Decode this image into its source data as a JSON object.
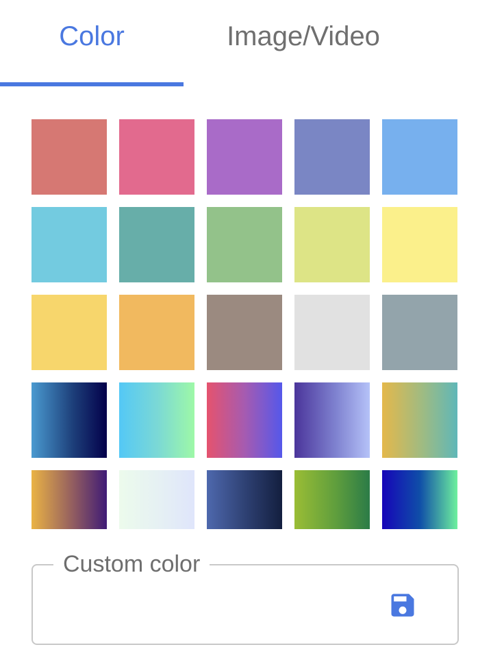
{
  "tabs": [
    {
      "label": "Color",
      "active": true
    },
    {
      "label": "Image/Video",
      "active": false
    }
  ],
  "colors": {
    "accent": "#4a78e0",
    "inactive_tab": "#6f6f6f",
    "input_border": "#c8c8c8"
  },
  "swatches": [
    {
      "name": "swatch-red",
      "fill": "#d67873"
    },
    {
      "name": "swatch-pink",
      "fill": "#e26a8e"
    },
    {
      "name": "swatch-purple",
      "fill": "#a96bc8"
    },
    {
      "name": "swatch-indigo",
      "fill": "#7a86c4"
    },
    {
      "name": "swatch-light-blue",
      "fill": "#77b0ee"
    },
    {
      "name": "swatch-cyan",
      "fill": "#73cbe0"
    },
    {
      "name": "swatch-teal",
      "fill": "#67aea9"
    },
    {
      "name": "swatch-green",
      "fill": "#93c28a"
    },
    {
      "name": "swatch-lime",
      "fill": "#dde486"
    },
    {
      "name": "swatch-yellow",
      "fill": "#fbf08b"
    },
    {
      "name": "swatch-amber",
      "fill": "#f7d66c"
    },
    {
      "name": "swatch-orange",
      "fill": "#f1b95f"
    },
    {
      "name": "swatch-brown",
      "fill": "#9b8a80"
    },
    {
      "name": "swatch-light-gray",
      "fill": "#e1e1e1"
    },
    {
      "name": "swatch-blue-gray",
      "fill": "#93a4ab"
    },
    {
      "name": "swatch-gradient-ocean",
      "fill": "linear-gradient(90deg, #4a9ad0 0%, #1d3f7a 55%, #03004a 100%)"
    },
    {
      "name": "swatch-gradient-sky-mint",
      "fill": "linear-gradient(90deg, #54c8f6 0%, #7ad8d6 50%, #9ef8a7 100%)"
    },
    {
      "name": "swatch-gradient-rose-blue",
      "fill": "linear-gradient(90deg, #e5536e 0%, #a65bb0 50%, #5558ea 100%)"
    },
    {
      "name": "swatch-gradient-violet-periwinkle",
      "fill": "linear-gradient(90deg, #4b359b 0%, #7f82d0 55%, #b5c2f8 100%)"
    },
    {
      "name": "swatch-gradient-gold-teal",
      "fill": "linear-gradient(90deg, #e4b84b 0%, #9dbb84 55%, #5fb7b8 100%)"
    },
    {
      "name": "swatch-gradient-sunset-violet",
      "fill": "linear-gradient(90deg, #eab345 0%, #925d60 55%, #3f1b76 100%)",
      "short": true
    },
    {
      "name": "swatch-gradient-mint-lavender",
      "fill": "linear-gradient(90deg, #ecfbec 0%, #e6f1f3 50%, #dfe5fb 100%)",
      "short": true
    },
    {
      "name": "swatch-gradient-navy",
      "fill": "linear-gradient(90deg, #4e68ad 0%, #2c3e6f 55%, #131f3f 100%)",
      "short": true
    },
    {
      "name": "swatch-gradient-forest",
      "fill": "linear-gradient(90deg, #9abd35 0%, #5f9e3d 55%, #2b7b47 100%)",
      "short": true
    },
    {
      "name": "swatch-gradient-cobalt-mint",
      "fill": "linear-gradient(90deg, #1605b8 0%, #0f4ea8 50%, #6ef09e 100%)",
      "short": true
    }
  ],
  "custom_color": {
    "label": "Custom color",
    "value": "",
    "placeholder": "",
    "save_icon": "save-icon"
  }
}
